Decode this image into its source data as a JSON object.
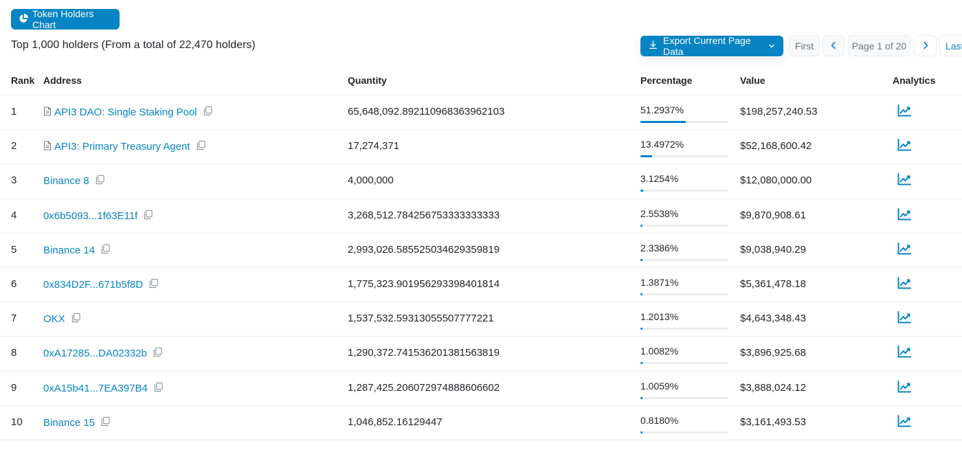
{
  "toolbar": {
    "chart_button_label": "Token Holders Chart",
    "chart_icon": "pie-chart-icon",
    "summary": "Top 1,000 holders (From a total of 22,470 holders)",
    "export_label": "Export Current Page Data",
    "export_icon": "download-icon"
  },
  "pagination": {
    "first": "First",
    "info": "Page 1 of 20",
    "last": "Last"
  },
  "table": {
    "headers": {
      "rank": "Rank",
      "address": "Address",
      "quantity": "Quantity",
      "percentage": "Percentage",
      "value": "Value",
      "analytics": "Analytics"
    },
    "rows": [
      {
        "rank": "1",
        "address": "API3 DAO: Single Staking Pool",
        "contract": true,
        "quantity": "65,648,092.892110968363962103",
        "percentage": "51.2937%",
        "pct": 51.2937,
        "value": "$198,257,240.53"
      },
      {
        "rank": "2",
        "address": "API3: Primary Treasury Agent",
        "contract": true,
        "quantity": "17,274,371",
        "percentage": "13.4972%",
        "pct": 13.4972,
        "value": "$52,168,600.42"
      },
      {
        "rank": "3",
        "address": "Binance 8",
        "contract": false,
        "quantity": "4,000,000",
        "percentage": "3.1254%",
        "pct": 3.1254,
        "value": "$12,080,000.00"
      },
      {
        "rank": "4",
        "address": "0x6b5093...1f63E11f",
        "contract": false,
        "quantity": "3,268,512.784256753333333333",
        "percentage": "2.5538%",
        "pct": 2.5538,
        "value": "$9,870,908.61"
      },
      {
        "rank": "5",
        "address": "Binance 14",
        "contract": false,
        "quantity": "2,993,026.585525034629359819",
        "percentage": "2.3386%",
        "pct": 2.3386,
        "value": "$9,038,940.29"
      },
      {
        "rank": "6",
        "address": "0x834D2F...671b5f8D",
        "contract": false,
        "quantity": "1,775,323.901956293398401814",
        "percentage": "1.3871%",
        "pct": 1.3871,
        "value": "$5,361,478.18"
      },
      {
        "rank": "7",
        "address": "OKX",
        "contract": false,
        "quantity": "1,537,532.59313055507777221",
        "percentage": "1.2013%",
        "pct": 1.2013,
        "value": "$4,643,348.43"
      },
      {
        "rank": "8",
        "address": "0xA17285...DA02332b",
        "contract": false,
        "quantity": "1,290,372.741536201381563819",
        "percentage": "1.0082%",
        "pct": 1.0082,
        "value": "$3,896,925.68"
      },
      {
        "rank": "9",
        "address": "0xA15b41...7EA397B4",
        "contract": false,
        "quantity": "1,287,425.206072974888606602",
        "percentage": "1.0059%",
        "pct": 1.0059,
        "value": "$3,888,024.12"
      },
      {
        "rank": "10",
        "address": "Binance 15",
        "contract": false,
        "quantity": "1,046,852.16129447",
        "percentage": "0.8180%",
        "pct": 0.818,
        "value": "$3,161,493.53"
      }
    ]
  },
  "colors": {
    "accent": "#0784c3",
    "border": "#e9ecef"
  }
}
